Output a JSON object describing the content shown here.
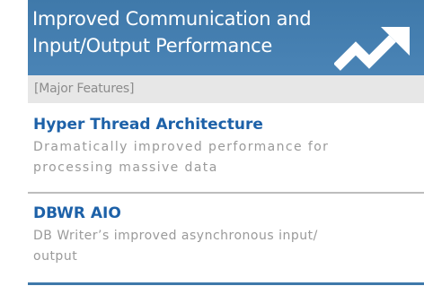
{
  "header": {
    "title": "Improved Communication and\nInput/Output Performance",
    "icon": "trend-up-arrow-icon",
    "background_color": "#4a84b6"
  },
  "section": {
    "label": "[Major Features]"
  },
  "features": [
    {
      "title": "Hyper Thread Architecture",
      "description": "Dramatically improved performance for processing massive data"
    },
    {
      "title": "DBWR AIO",
      "description": "DB Writer’s improved asynchronous input/ output"
    }
  ],
  "colors": {
    "accent": "#1d61a8",
    "banner": "#4a84b6",
    "section_bar": "#e7e7e7",
    "muted_text": "#9a9a9a"
  }
}
